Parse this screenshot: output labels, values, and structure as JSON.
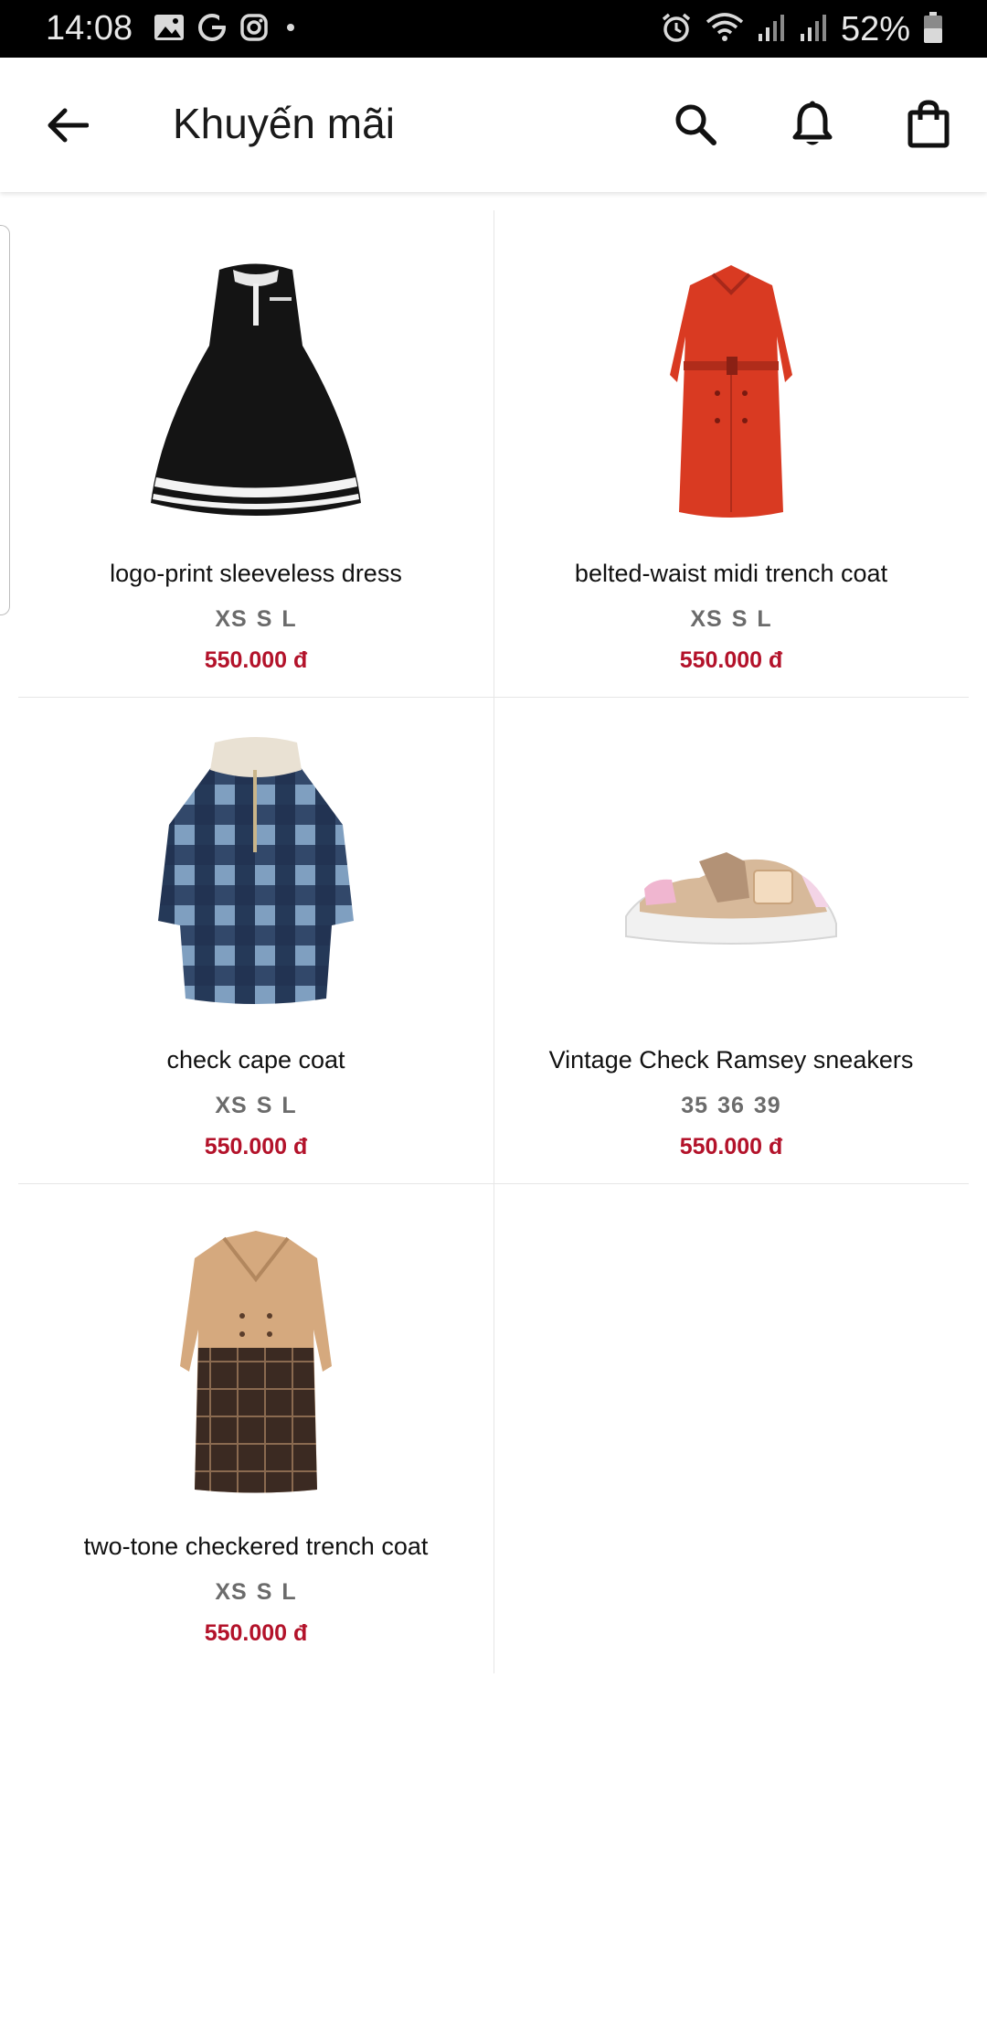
{
  "status_bar": {
    "time": "14:08",
    "battery_text": "52%",
    "left_icons": [
      "gallery-icon",
      "g-app-icon",
      "instagram-icon",
      "dot-icon"
    ],
    "right_icons": [
      "alarm-icon",
      "wifi-icon",
      "signal-icon",
      "signal-icon",
      "battery-icon"
    ]
  },
  "appbar": {
    "title": "Khuyến mãi",
    "back_icon": "arrow-left-icon",
    "actions": [
      "search-icon",
      "bell-icon",
      "shopping-bag-icon"
    ]
  },
  "products": [
    {
      "name": "logo-print sleeveless dress",
      "sizes": [
        "XS",
        "S",
        "L"
      ],
      "price": "550.000 đ",
      "image": "black-dress"
    },
    {
      "name": "belted-waist midi trench coat",
      "sizes": [
        "XS",
        "S",
        "L"
      ],
      "price": "550.000 đ",
      "image": "red-trench-coat"
    },
    {
      "name": "check cape coat",
      "sizes": [
        "XS",
        "S",
        "L"
      ],
      "price": "550.000 đ",
      "image": "plaid-cape-coat"
    },
    {
      "name": "Vintage Check Ramsey sneakers",
      "sizes": [
        "35",
        "36",
        "39"
      ],
      "price": "550.000 đ",
      "image": "check-sneaker"
    },
    {
      "name": "two-tone checkered trench coat",
      "sizes": [
        "XS",
        "S",
        "L"
      ],
      "price": "550.000 đ",
      "image": "two-tone-trench"
    }
  ],
  "colors": {
    "price": "#b3122a",
    "status_bar_bg": "#000000"
  }
}
